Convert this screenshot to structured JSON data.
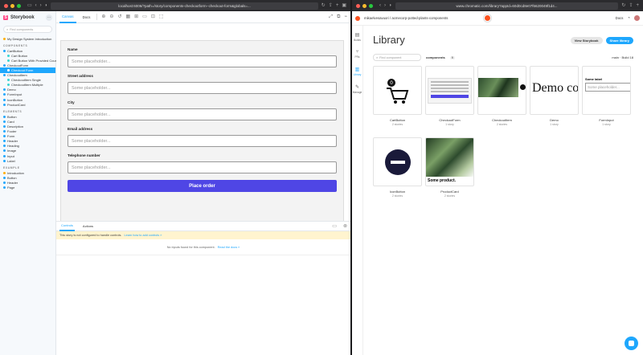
{
  "left": {
    "chrome_url": "localhost:6006/?path=/story/components-checkoutform--checkout-form&globals=...",
    "brand": "Storybook",
    "search_placeholder": "Find components",
    "tree": [
      {
        "type": "item",
        "level": 1,
        "label": "My Design System Introduction",
        "color": "#ffae00"
      },
      {
        "type": "cat",
        "label": "COMPONENTS"
      },
      {
        "type": "item",
        "level": 1,
        "label": "CartButton",
        "color": "#1ea7fd"
      },
      {
        "type": "item",
        "level": 2,
        "label": "Cart Button",
        "color": "#37d5d3"
      },
      {
        "type": "item",
        "level": 2,
        "label": "Cart Button With Provided Count",
        "color": "#37d5d3"
      },
      {
        "type": "item",
        "level": 1,
        "label": "CheckoutForm",
        "color": "#1ea7fd"
      },
      {
        "type": "item",
        "level": 2,
        "label": "Checkout Form",
        "color": "#ffffff",
        "selected": true
      },
      {
        "type": "item",
        "level": 1,
        "label": "CheckoutItem",
        "color": "#1ea7fd"
      },
      {
        "type": "item",
        "level": 2,
        "label": "CheckoutItem Single",
        "color": "#37d5d3"
      },
      {
        "type": "item",
        "level": 2,
        "label": "CheckoutItem Multiple",
        "color": "#37d5d3"
      },
      {
        "type": "item",
        "level": 1,
        "label": "Demo",
        "color": "#1ea7fd"
      },
      {
        "type": "item",
        "level": 1,
        "label": "FormInput",
        "color": "#1ea7fd"
      },
      {
        "type": "item",
        "level": 1,
        "label": "IconButton",
        "color": "#1ea7fd"
      },
      {
        "type": "item",
        "level": 1,
        "label": "ProductCard",
        "color": "#1ea7fd"
      },
      {
        "type": "cat",
        "label": "ELEMENTS"
      },
      {
        "type": "item",
        "level": 1,
        "label": "Button",
        "color": "#1ea7fd"
      },
      {
        "type": "item",
        "level": 1,
        "label": "Card",
        "color": "#1ea7fd"
      },
      {
        "type": "item",
        "level": 1,
        "label": "Description",
        "color": "#1ea7fd"
      },
      {
        "type": "item",
        "level": 1,
        "label": "Footer",
        "color": "#1ea7fd"
      },
      {
        "type": "item",
        "level": 1,
        "label": "Form",
        "color": "#1ea7fd"
      },
      {
        "type": "item",
        "level": 1,
        "label": "Header",
        "color": "#1ea7fd"
      },
      {
        "type": "item",
        "level": 1,
        "label": "Heading",
        "color": "#1ea7fd"
      },
      {
        "type": "item",
        "level": 1,
        "label": "Image",
        "color": "#1ea7fd"
      },
      {
        "type": "item",
        "level": 1,
        "label": "Input",
        "color": "#1ea7fd"
      },
      {
        "type": "item",
        "level": 1,
        "label": "Label",
        "color": "#1ea7fd"
      },
      {
        "type": "cat",
        "label": "EXAMPLE"
      },
      {
        "type": "item",
        "level": 1,
        "label": "Introduction",
        "color": "#ffae00"
      },
      {
        "type": "item",
        "level": 1,
        "label": "Button",
        "color": "#1ea7fd"
      },
      {
        "type": "item",
        "level": 1,
        "label": "Header",
        "color": "#1ea7fd"
      },
      {
        "type": "item",
        "level": 1,
        "label": "Page",
        "color": "#1ea7fd"
      }
    ],
    "tabs": {
      "canvas": "Canvas",
      "docs": "Docs"
    },
    "form": {
      "fields": [
        {
          "label": "Name",
          "placeholder": "Some placeholder..."
        },
        {
          "label": "Street address",
          "placeholder": "Some placeholder..."
        },
        {
          "label": "City",
          "placeholder": "Some placeholder..."
        },
        {
          "label": "Email address",
          "placeholder": "Some placeholder..."
        },
        {
          "label": "Telephone number",
          "placeholder": "Some placeholder..."
        }
      ],
      "submit": "Place order"
    },
    "addons": {
      "tab_controls": "Controls",
      "tab_actions": "Actions",
      "warning": "This story is not configured to handle controls.",
      "warning_link": "Learn how to add controls »",
      "no_inputs": "No inputs found for this component.",
      "no_inputs_link": "Read the docs »"
    }
  },
  "right": {
    "chrome_url": "www.chromatic.com/library?appId=60d0cd8e07f6620049f1d4...",
    "project": "mikaelvesavuori / acmecorp-potted-plants-components",
    "docs": "Docs",
    "rail": [
      "Builds",
      "PRs",
      "Library",
      "Manage"
    ],
    "title": "Library",
    "btn_view": "View Storybook",
    "btn_share": "Share library",
    "search_placeholder": "Find component",
    "components_label": "components",
    "components_count": "9",
    "branch": "main · Build 18",
    "cards": [
      {
        "name": "CartButton",
        "sub": "2 stories",
        "thumb": "cart"
      },
      {
        "name": "CheckoutForm",
        "sub": "1 story",
        "thumb": "form"
      },
      {
        "name": "CheckoutItem",
        "sub": "2 stories",
        "thumb": "item"
      },
      {
        "name": "Demo",
        "sub": "1 story",
        "thumb": "demo",
        "demo_text": "Demo co"
      },
      {
        "name": "FormInput",
        "sub": "1 story",
        "thumb": "input",
        "input_label": "Some label",
        "input_placeholder": "Some placeholder..."
      },
      {
        "name": "IconButton",
        "sub": "2 stories",
        "thumb": "icon"
      },
      {
        "name": "ProductCard",
        "sub": "2 stories",
        "thumb": "product",
        "product_text": "Some product."
      }
    ]
  }
}
